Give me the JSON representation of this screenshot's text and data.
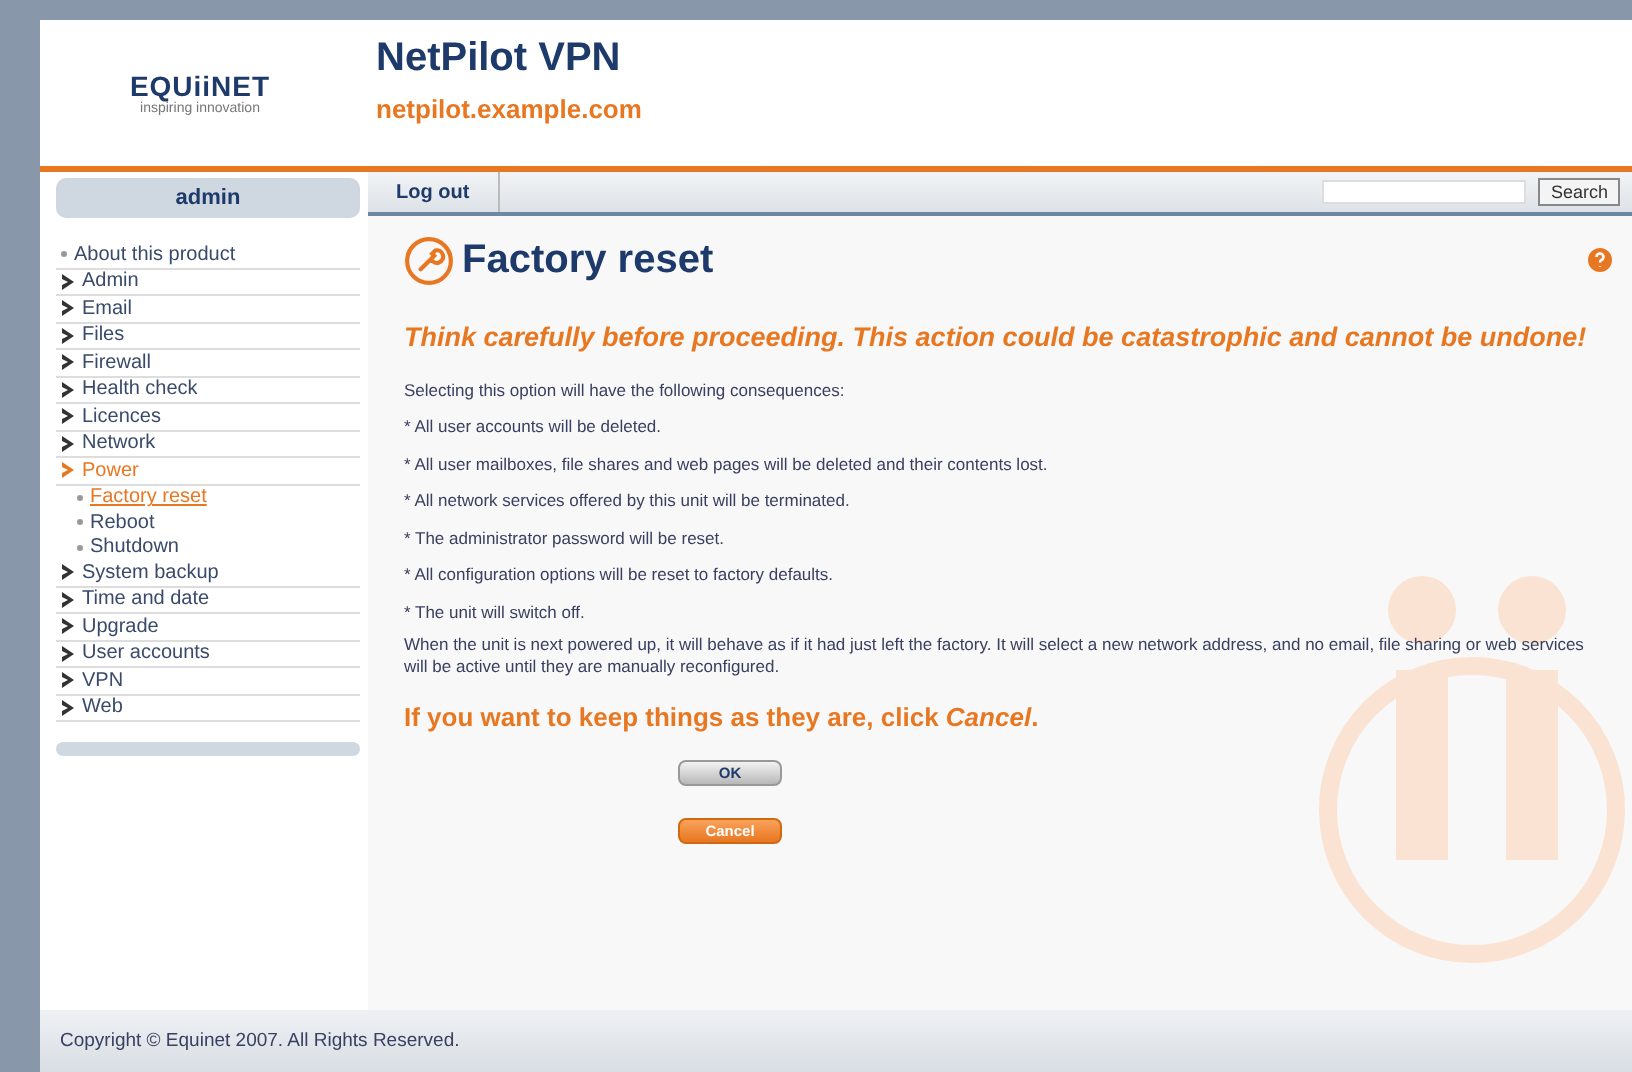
{
  "header": {
    "logo": "EQUiiNET",
    "tagline": "inspiring innovation",
    "title": "NetPilot VPN",
    "hostname": "netpilot.example.com"
  },
  "sidebar": {
    "user": "admin",
    "items": [
      {
        "label": "About this product",
        "kind": "page",
        "selected": false
      },
      {
        "label": "Admin",
        "kind": "section",
        "selected": false
      },
      {
        "label": "Email",
        "kind": "section",
        "selected": false
      },
      {
        "label": "Files",
        "kind": "section",
        "selected": false
      },
      {
        "label": "Firewall",
        "kind": "section",
        "selected": false
      },
      {
        "label": "Health check",
        "kind": "section",
        "selected": false
      },
      {
        "label": "Licences",
        "kind": "section",
        "selected": false
      },
      {
        "label": "Network",
        "kind": "section",
        "selected": false
      },
      {
        "label": "Power",
        "kind": "section",
        "selected": true,
        "children": [
          {
            "label": "Factory reset",
            "kind": "page",
            "selected": true
          },
          {
            "label": "Reboot",
            "kind": "page",
            "selected": false
          },
          {
            "label": "Shutdown",
            "kind": "page",
            "selected": false
          }
        ]
      },
      {
        "label": "System backup",
        "kind": "section",
        "selected": false
      },
      {
        "label": "Time and date",
        "kind": "section",
        "selected": false
      },
      {
        "label": "Upgrade",
        "kind": "section",
        "selected": false
      },
      {
        "label": "User accounts",
        "kind": "section",
        "selected": false
      },
      {
        "label": "VPN",
        "kind": "section",
        "selected": false
      },
      {
        "label": "Web",
        "kind": "section",
        "selected": false
      }
    ]
  },
  "toolbar": {
    "logout": "Log out",
    "search_button": "Search"
  },
  "page": {
    "title": "Factory reset",
    "warning": "Think carefully before proceeding. This action could be catastrophic and cannot be undone!",
    "intro": "Selecting this option will have the following consequences:",
    "consequences": [
      "* All user accounts will be deleted.",
      "* All user mailboxes, file shares and web pages will be deleted and their contents lost.",
      "* All network services offered by this unit will be terminated.",
      "* The administrator password will be reset.",
      "* All configuration options will be reset to factory defaults.",
      "* The unit will switch off."
    ],
    "outro": "When the unit is next powered up, it will behave as if it had just left the factory. It will select a new network address, and no email, file sharing or web services will be active until they are manually reconfigured.",
    "prompt": "If you want to keep things as they are, click *Cancel*.",
    "buttons": [
      {
        "label": "OK",
        "kind": "plain"
      },
      {
        "label": "Cancel",
        "kind": "accent"
      }
    ]
  },
  "footer": "Copyright © Equinet 2007. All Rights Reserved."
}
